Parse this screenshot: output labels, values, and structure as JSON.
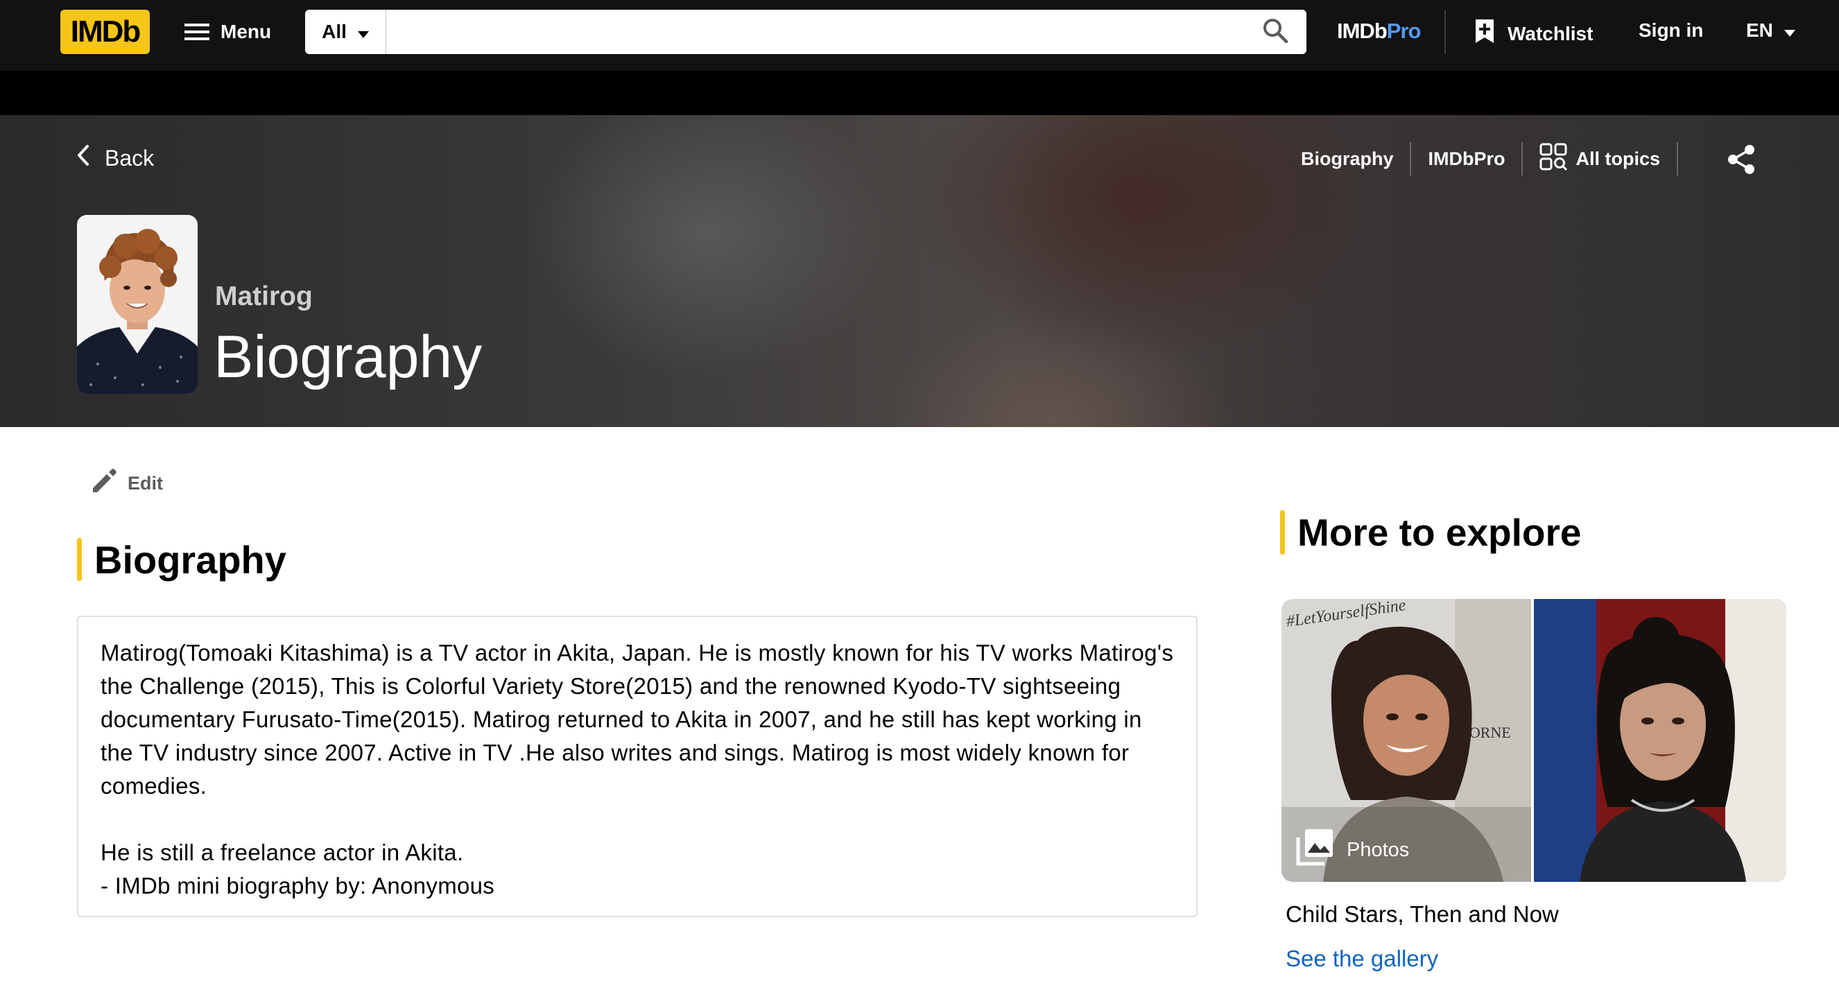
{
  "header": {
    "logo_text": "IMDb",
    "menu_label": "Menu",
    "search_category": "All",
    "search_placeholder": "",
    "pro_logo_main": "IMDb",
    "pro_logo_suffix": "Pro",
    "watchlist_label": "Watchlist",
    "signin_label": "Sign in",
    "language": "EN"
  },
  "hero": {
    "back_label": "Back",
    "links": [
      "Biography",
      "IMDbPro",
      "All topics"
    ],
    "subject_name": "Matirog",
    "page_title": "Biography"
  },
  "main": {
    "edit_label": "Edit",
    "section_title": "Biography",
    "bio_paragraph": "Matirog(Tomoaki Kitashima) is a TV actor in Akita, Japan. He is mostly known for his TV works Matirog's the Challenge (2015), This is Colorful Variety Store(2015) and the renowned Kyodo-TV sightseeing documentary Furusato-Time(2015). Matirog returned to Akita in 2007, and he still has kept working in the TV industry since 2007. Active in TV .He also writes and sings. Matirog is most widely known for comedies.",
    "bio_line2": "He is still a freelance actor in Akita.",
    "bio_credit": "- IMDb mini biography by: Anonymous"
  },
  "sidebar": {
    "section_title": "More to explore",
    "gallery_badge": "Photos",
    "gallery_caption": "Child Stars, Then and Now",
    "gallery_link": "See the gallery",
    "photo_sign_text": "#LetYourselfShine",
    "photo_backdrop_text": "HORNE"
  },
  "colors": {
    "brand_yellow": "#f5c518",
    "nav_bg": "#121212",
    "link_blue": "#0e63be",
    "pro_blue": "#5799ef"
  },
  "icons": [
    "menu-icon",
    "caret-down-icon",
    "search-icon",
    "watchlist-add-icon",
    "chevron-left-icon",
    "all-topics-icon",
    "share-icon",
    "pencil-icon",
    "photos-icon"
  ]
}
